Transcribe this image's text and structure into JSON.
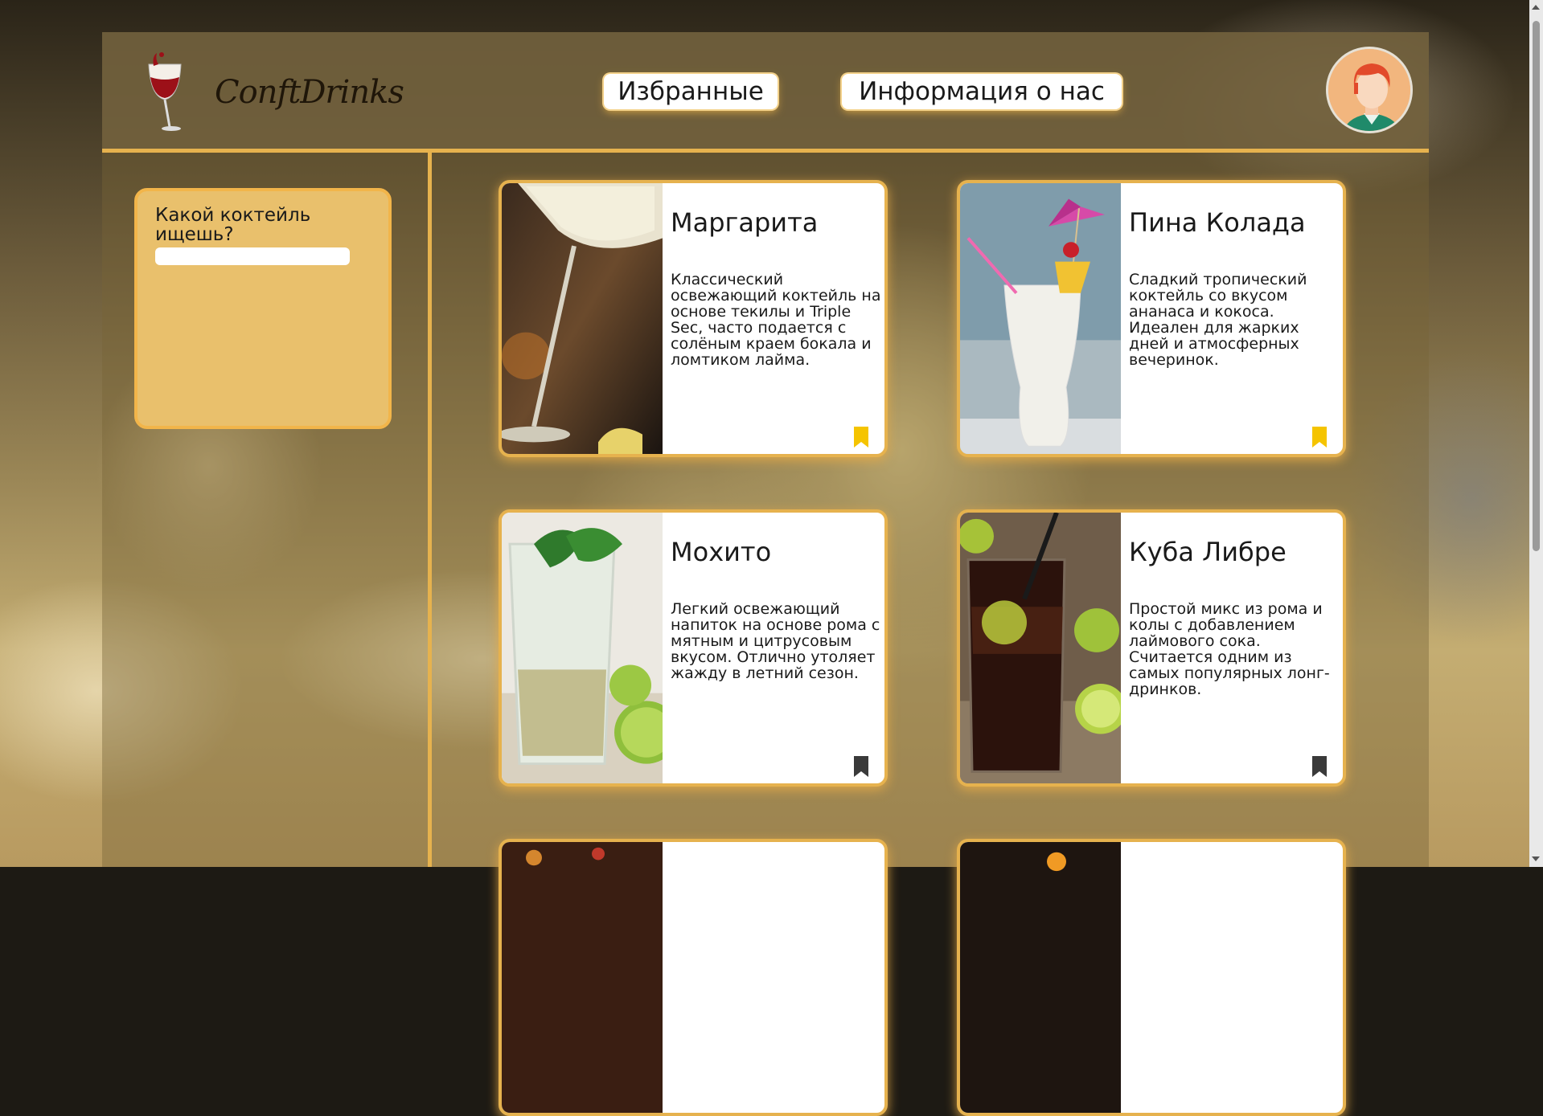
{
  "brand": {
    "name": "ConftDrinks"
  },
  "nav": {
    "favorites_label": "Избранные",
    "about_label": "Информация о нас"
  },
  "search": {
    "label": "Какой коктейль ищешь?",
    "value": ""
  },
  "cards": [
    {
      "title": "Маргарита",
      "description": "Классический освежающий коктейль на основе текилы и Triple Sec, часто подается с солёным краем бокала и ломтиком лайма.",
      "bookmarked": true
    },
    {
      "title": "Пина Колада",
      "description": "Сладкий тропический коктейль со вкусом ананаса и кокоса. Идеален для жарких дней и атмосферных вечеринок.",
      "bookmarked": true
    },
    {
      "title": "Мохито",
      "description": "Легкий освежающий напиток на основе рома с мятным и цитрусовым вкусом. Отлично утоляет жажду в летний сезон.",
      "bookmarked": false
    },
    {
      "title": "Куба Либре",
      "description": "Простой микс из рома и колы с добавлением лаймового сока. Считается одним из самых популярных лонг-дринков.",
      "bookmarked": false
    }
  ],
  "colors": {
    "accent": "#e6b24e",
    "bookmark_active": "#f5c400",
    "bookmark_inactive": "#3a3a3a"
  }
}
